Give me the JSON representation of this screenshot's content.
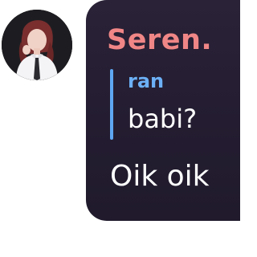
{
  "message": {
    "author": "Seren.",
    "author_color": "#f08686",
    "text": "Oik oik",
    "reply": {
      "author": "ran",
      "author_color": "#6cb0f6",
      "text": "babi?"
    }
  },
  "avatar": {
    "icon": "profile-photo"
  }
}
